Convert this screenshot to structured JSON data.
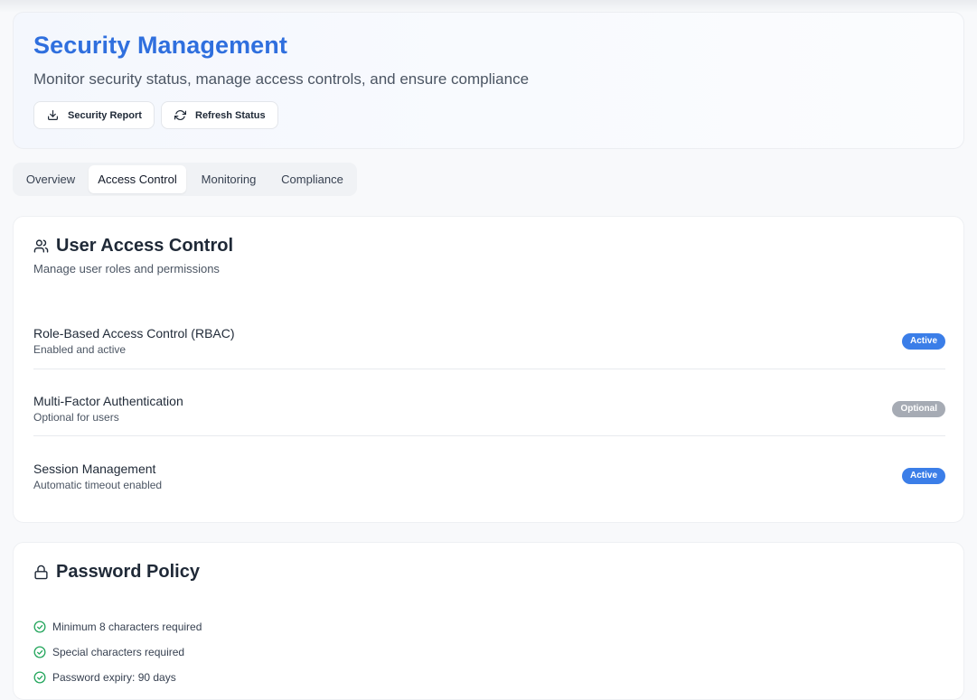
{
  "header": {
    "title": "Security Management",
    "subtitle": "Monitor security status, manage access controls, and ensure compliance",
    "buttons": {
      "report": {
        "label": "Security Report",
        "icon": "download-icon"
      },
      "refresh": {
        "label": "Refresh Status",
        "icon": "refresh-icon"
      }
    }
  },
  "tabs": {
    "overview": "Overview",
    "access": "Access Control",
    "monitoring": "Monitoring",
    "compliance": "Compliance",
    "selected": "Access Control"
  },
  "access_card": {
    "icon": "users-icon",
    "title": "User Access Control",
    "description": "Manage user roles and permissions",
    "rows": [
      {
        "label": "Role-Based Access Control (RBAC)",
        "sub": "Enabled and active",
        "badge": "Active",
        "status": "active"
      },
      {
        "label": "Multi-Factor Authentication",
        "sub": "Optional for users",
        "badge": "Optional",
        "status": "optional"
      },
      {
        "label": "Session Management",
        "sub": "Automatic timeout enabled",
        "badge": "Active",
        "status": "active"
      }
    ]
  },
  "password_card": {
    "icon": "lock-icon",
    "title": "Password Policy",
    "items": [
      "Minimum 8 characters required",
      "Special characters required",
      "Password expiry: 90 days"
    ]
  },
  "colors": {
    "title_blue": "#2f6fde",
    "badge_active": "#3b7ee8",
    "badge_optional": "#a6abb4",
    "check_green": "#22a55b"
  }
}
